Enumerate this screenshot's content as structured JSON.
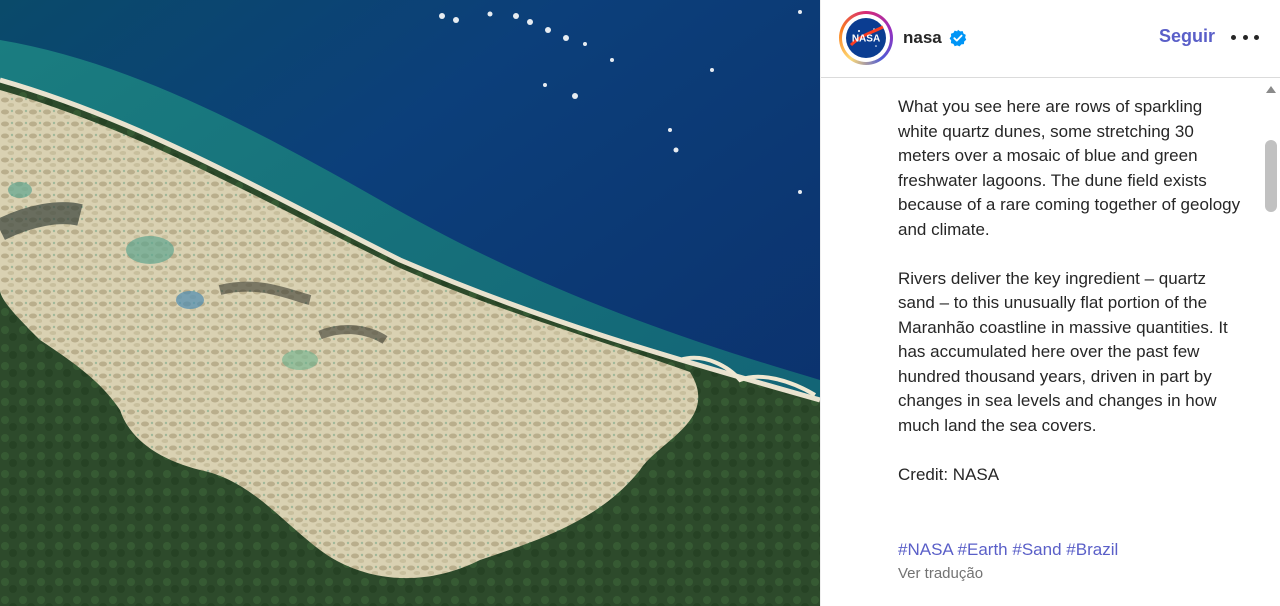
{
  "post": {
    "author": {
      "username": "nasa",
      "avatar_logo_text": "NASA",
      "verified": true
    },
    "follow_label": "Seguir",
    "more_icon": "more-horizontal-icon",
    "caption_paragraphs": [
      "What you see here are rows of sparkling white quartz dunes, some stretching 30 meters over a mosaic of blue and green freshwater lagoons. The dune field exists because of a rare coming together of geology and climate.",
      "Rivers deliver the key ingredient – quartz sand – to this unusually flat portion of the Maranhão coastline in massive quantities. It has accumulated here over the past few hundred thousand years, driven in part by changes in sea levels and changes in how much land the sea covers.",
      "Credit: NASA"
    ],
    "hashtags": [
      "#NASA",
      "#Earth",
      "#Sand",
      "#Brazil"
    ],
    "translate_label": "Ver tradução"
  },
  "colors": {
    "accent": "#5a5fc8",
    "verified": "#0095f6",
    "text": "#262626",
    "muted": "#737373",
    "ocean_deep": "#0d3a6e",
    "ocean_shallow": "#1d6f78",
    "dunes": "#d8cfb0",
    "forest": "#2f4a2a"
  }
}
